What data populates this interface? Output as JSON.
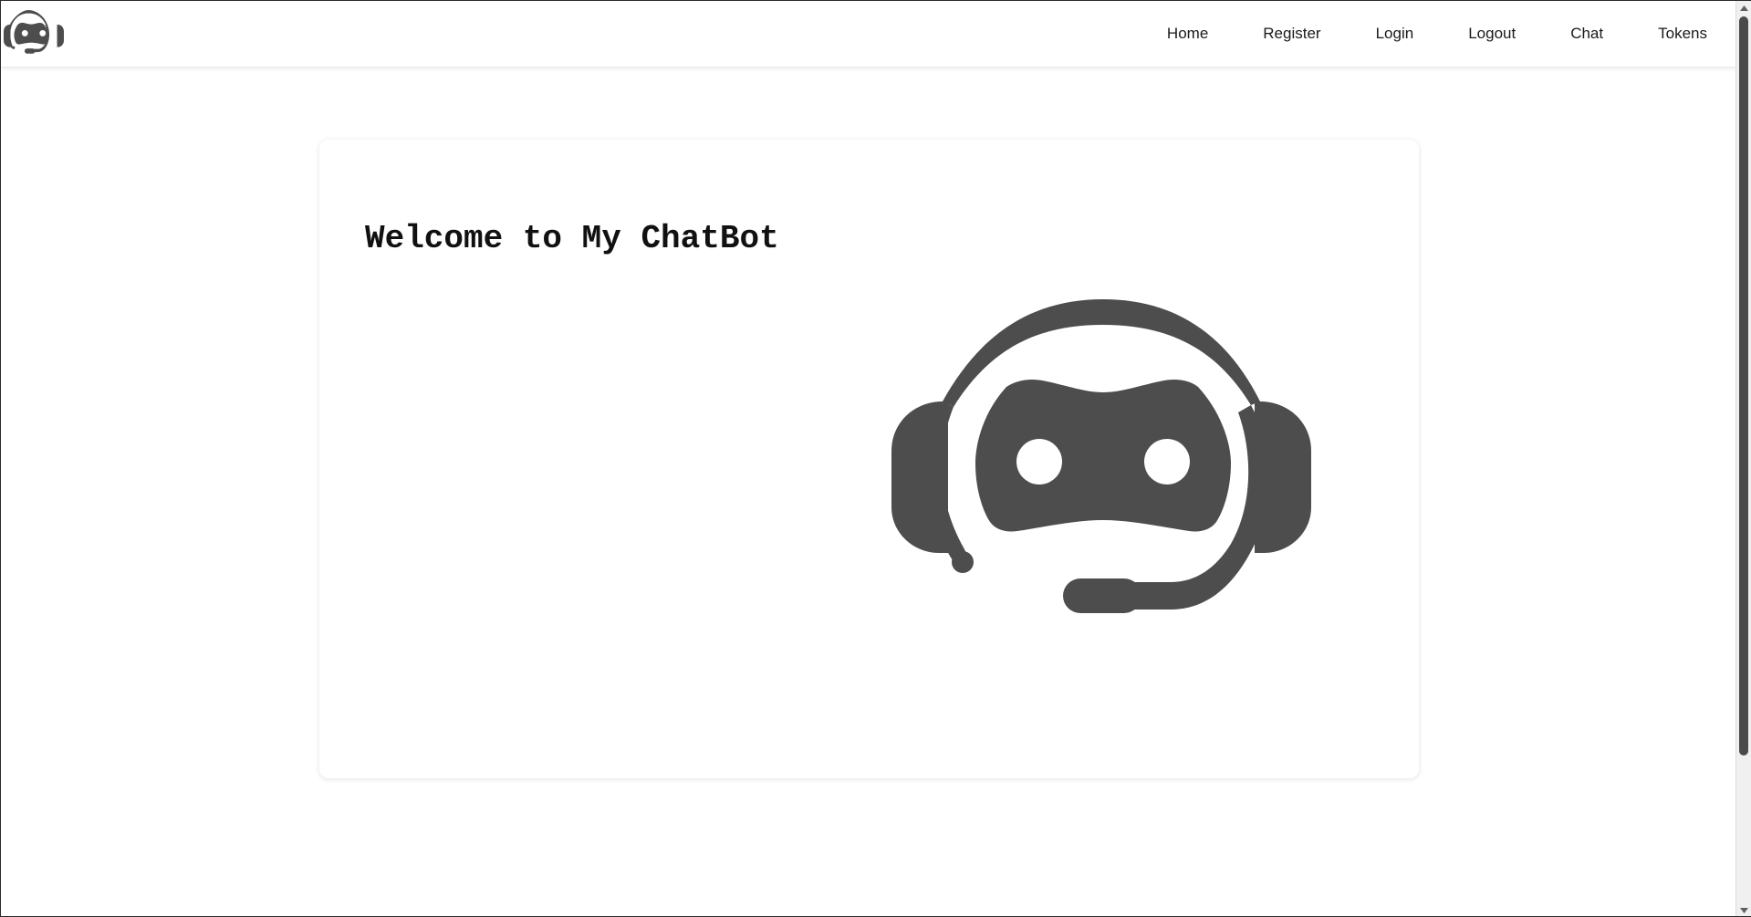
{
  "navbar": {
    "logo_icon": "robot-headset-icon",
    "links": [
      {
        "label": "Home"
      },
      {
        "label": "Register"
      },
      {
        "label": "Login"
      },
      {
        "label": "Logout"
      },
      {
        "label": "Chat"
      },
      {
        "label": "Tokens"
      }
    ]
  },
  "main": {
    "title": "Welcome to My ChatBot",
    "hero_icon": "robot-headset-icon"
  },
  "colors": {
    "icon_fill": "#4d4d4d",
    "text": "#111111",
    "background": "#ffffff"
  }
}
